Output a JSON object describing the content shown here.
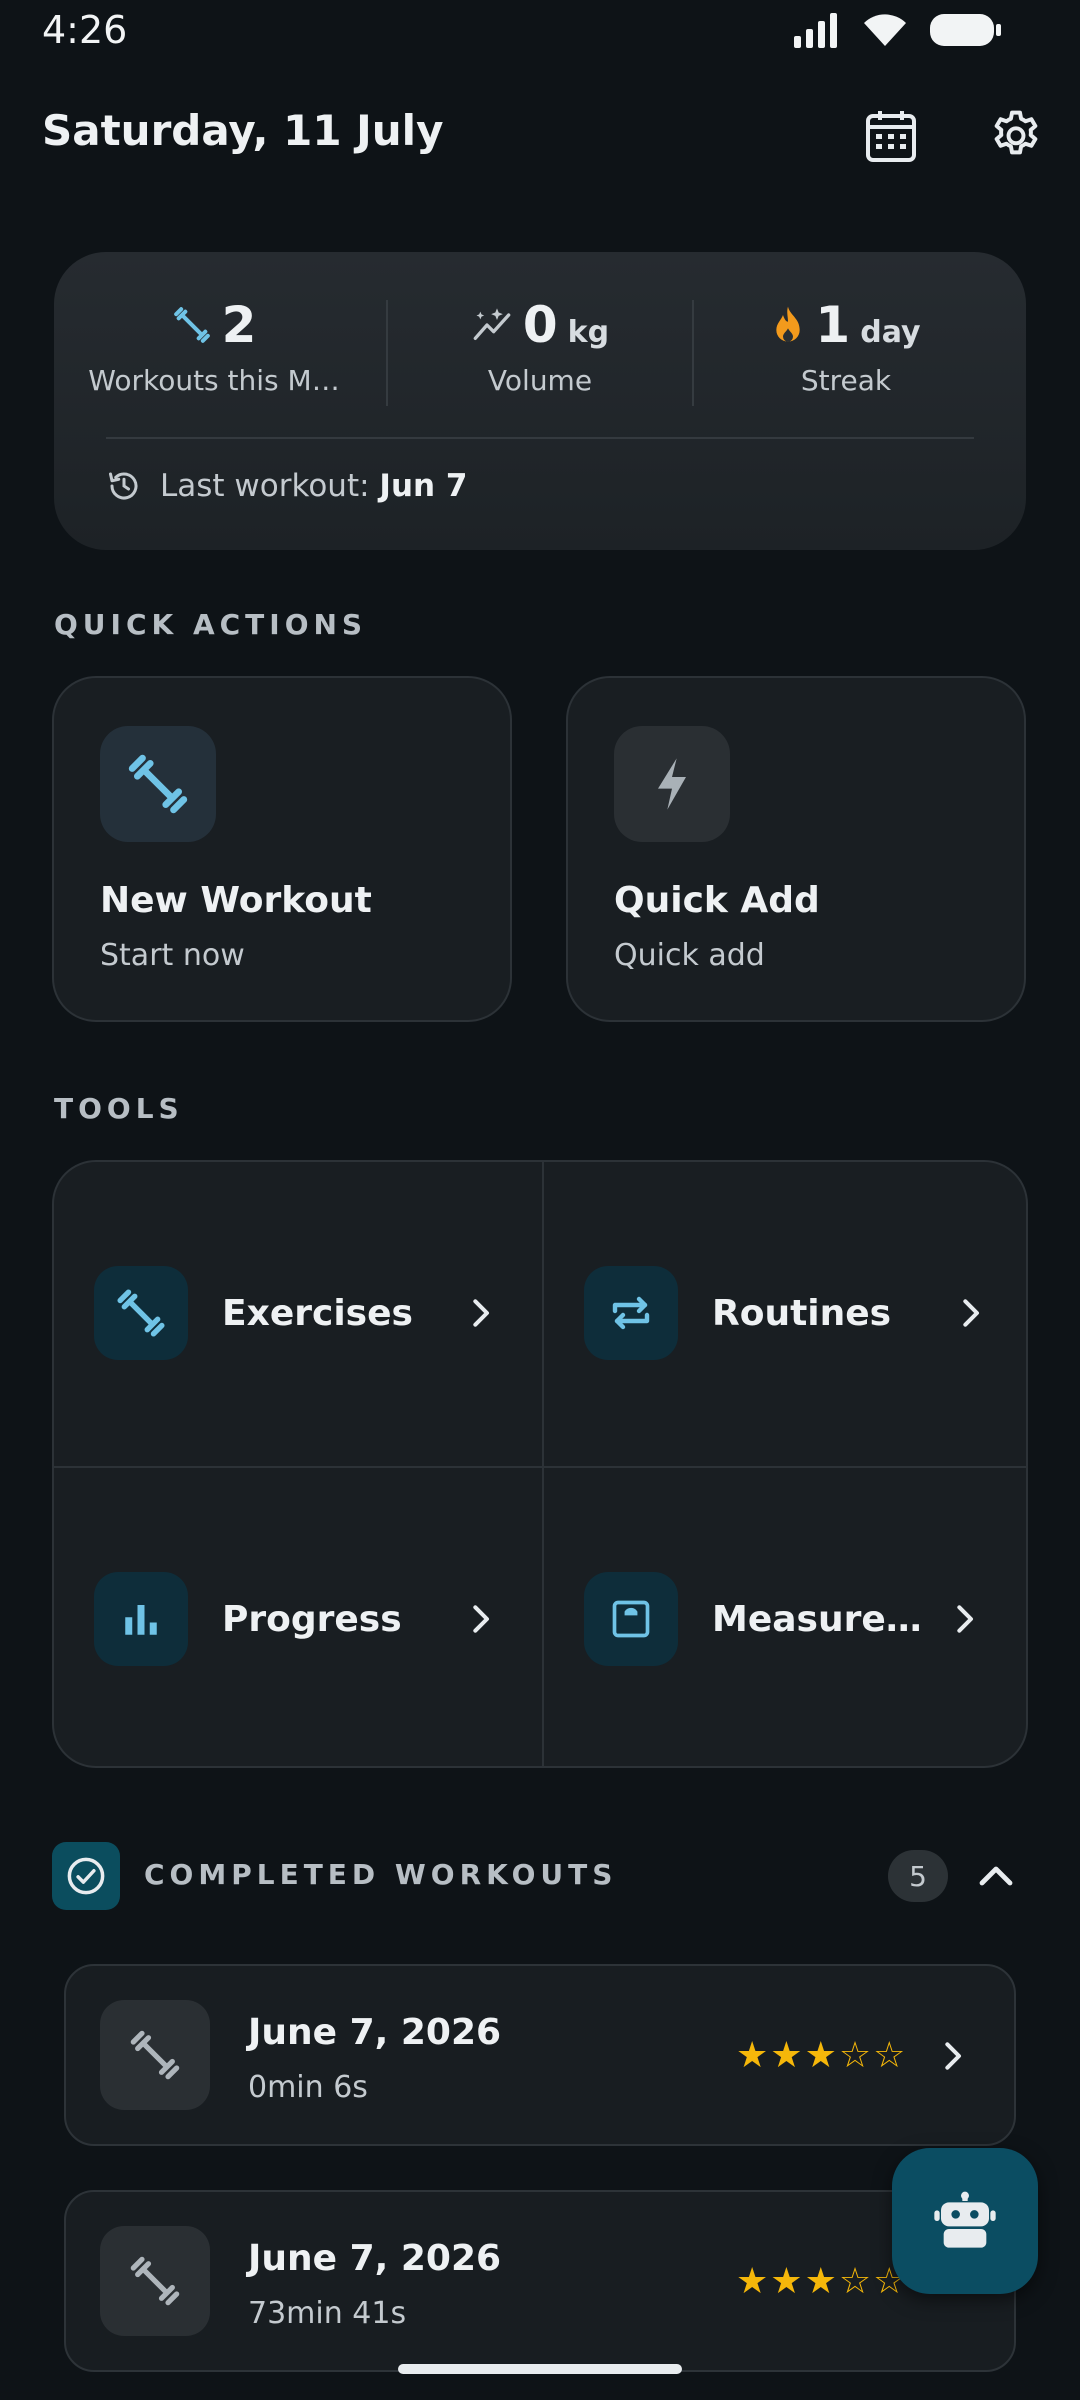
{
  "status_bar": {
    "time": "4:26"
  },
  "header": {
    "date": "Saturday, 11 July",
    "calendar_icon": "calendar-icon",
    "settings_icon": "gear-icon"
  },
  "stats": {
    "workouts": {
      "value": "2",
      "label": "Workouts this M…"
    },
    "volume": {
      "value": "0",
      "unit": "kg",
      "label": "Volume"
    },
    "streak": {
      "value": "1",
      "unit": "day",
      "label": "Streak"
    },
    "last_workout_prefix": "Last workout:",
    "last_workout_value": "Jun 7"
  },
  "quick_actions": {
    "title": "QUICK ACTIONS",
    "items": [
      {
        "title": "New Workout",
        "subtitle": "Start now",
        "icon": "dumbbell-icon"
      },
      {
        "title": "Quick Add",
        "subtitle": "Quick add",
        "icon": "lightning-icon"
      }
    ]
  },
  "tools": {
    "title": "TOOLS",
    "items": [
      {
        "label": "Exercises",
        "icon": "dumbbell-icon"
      },
      {
        "label": "Routines",
        "icon": "repeat-icon"
      },
      {
        "label": "Progress",
        "icon": "bar-chart-icon"
      },
      {
        "label": "Measurem…",
        "icon": "scale-icon"
      }
    ]
  },
  "completed": {
    "title": "COMPLETED WORKOUTS",
    "count": "5",
    "items": [
      {
        "date": "June 7, 2026",
        "duration": "0min 6s",
        "rating": 3,
        "max_rating": 5
      },
      {
        "date": "June 7, 2026",
        "duration": "73min 41s",
        "rating": 3,
        "max_rating": 5
      }
    ]
  },
  "colors": {
    "accent": "#0b4d62",
    "accent_icon": "#6fc3e6",
    "star": "#f5b70a",
    "background": "#0e1317",
    "fire": "#f39a1c"
  }
}
